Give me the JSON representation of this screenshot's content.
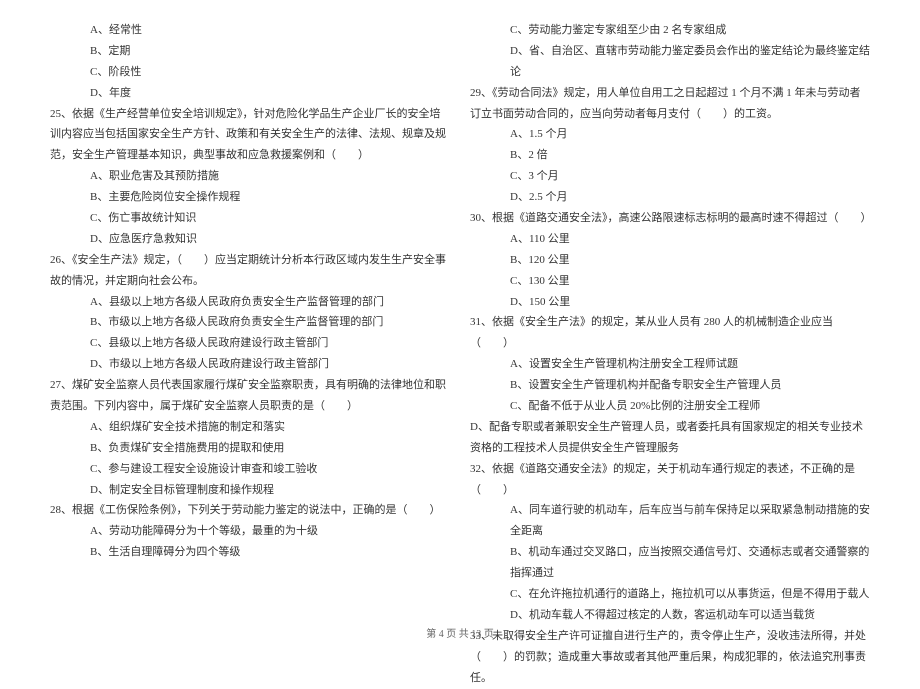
{
  "left": {
    "opt_24A": "A、经常性",
    "opt_24B": "B、定期",
    "opt_24C": "C、阶段性",
    "opt_24D": "D、年度",
    "q25": "25、依据《生产经营单位安全培训规定》，针对危险化学品生产企业厂长的安全培训内容应当包括国家安全生产方针、政策和有关安全生产的法律、法规、规章及规范，安全生产管理基本知识，典型事故和应急救援案例和（　　）",
    "opt_25A": "A、职业危害及其预防措施",
    "opt_25B": "B、主要危险岗位安全操作规程",
    "opt_25C": "C、伤亡事故统计知识",
    "opt_25D": "D、应急医疗急救知识",
    "q26": "26、《安全生产法》规定，（　　）应当定期统计分析本行政区域内发生生产安全事故的情况，并定期向社会公布。",
    "opt_26A": "A、县级以上地方各级人民政府负责安全生产监督管理的部门",
    "opt_26B": "B、市级以上地方各级人民政府负责安全生产监督管理的部门",
    "opt_26C": "C、县级以上地方各级人民政府建设行政主管部门",
    "opt_26D": "D、市级以上地方各级人民政府建设行政主管部门",
    "q27": "27、煤矿安全监察人员代表国家履行煤矿安全监察职责，具有明确的法律地位和职责范围。下列内容中，属于煤矿安全监察人员职责的是（　　）",
    "opt_27A": "A、组织煤矿安全技术措施的制定和落实",
    "opt_27B": "B、负责煤矿安全措施费用的提取和使用",
    "opt_27C": "C、参与建设工程安全设施设计审查和竣工验收",
    "opt_27D": "D、制定安全目标管理制度和操作规程",
    "q28": "28、根据《工伤保险条例》，下列关于劳动能力鉴定的说法中，正确的是（　　）",
    "opt_28A": "A、劳动功能障碍分为十个等级，最重的为十级",
    "opt_28B": "B、生活自理障碍分为四个等级"
  },
  "right": {
    "opt_28C": "C、劳动能力鉴定专家组至少由 2 名专家组成",
    "opt_28D": "D、省、自治区、直辖市劳动能力鉴定委员会作出的鉴定结论为最终鉴定结论",
    "q29": "29、《劳动合同法》规定，用人单位自用工之日起超过 1 个月不满 1 年未与劳动者订立书面劳动合同的，应当向劳动者每月支付（　　）的工资。",
    "opt_29A": "A、1.5 个月",
    "opt_29B": "B、2 倍",
    "opt_29C": "C、3 个月",
    "opt_29D": "D、2.5 个月",
    "q30": "30、根据《道路交通安全法》，高速公路限速标志标明的最高时速不得超过（　　）",
    "opt_30A": "A、110 公里",
    "opt_30B": "B、120 公里",
    "opt_30C": "C、130 公里",
    "opt_30D": "D、150 公里",
    "q31": "31、依据《安全生产法》的规定，某从业人员有 280 人的机械制造企业应当（　　）",
    "opt_31A": "A、设置安全生产管理机构注册安全工程师试题",
    "opt_31B": "B、设置安全生产管理机构并配备专职安全生产管理人员",
    "opt_31C": "C、配备不低于从业人员 20%比例的注册安全工程师",
    "opt_31D": "D、配备专职或者兼职安全生产管理人员，或者委托具有国家规定的相关专业技术资格的工程技术人员提供安全生产管理服务",
    "q32": "32、依据《道路交通安全法》的规定，关于机动车通行规定的表述，不正确的是（　　）",
    "opt_32A": "A、同车道行驶的机动车，后车应当与前车保持足以采取紧急制动措施的安全距离",
    "opt_32B": "B、机动车通过交叉路口，应当按照交通信号灯、交通标志或者交通警察的指挥通过",
    "opt_32C": "C、在允许拖拉机通行的道路上，拖拉机可以从事货运，但是不得用于载人",
    "opt_32D": "D、机动车载人不得超过核定的人数，客运机动车可以适当载货",
    "q33": "33、未取得安全生产许可证擅自进行生产的，责令停止生产，没收违法所得，并处（　　）的罚款；造成重大事故或者其他严重后果，构成犯罪的，依法追究刑事责任。"
  },
  "footer": "第 4 页 共 13 页"
}
